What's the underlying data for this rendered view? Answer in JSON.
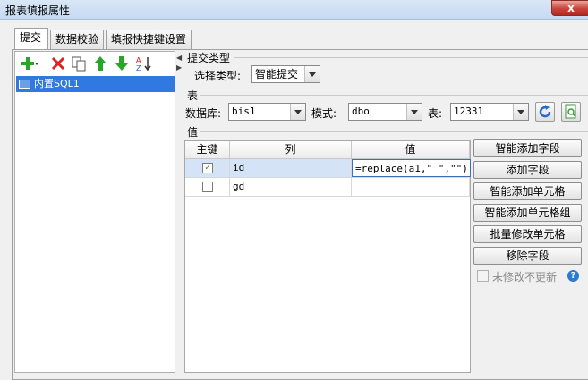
{
  "window": {
    "title": "报表填报属性",
    "close_label": "x"
  },
  "tabs": [
    {
      "label": "提交"
    },
    {
      "label": "数据校验"
    },
    {
      "label": "填报快捷键设置"
    }
  ],
  "left_panel": {
    "tree_items": [
      {
        "label": "内置SQL1"
      }
    ]
  },
  "submit_type": {
    "group_label": "提交类型",
    "label": "选择类型:",
    "value": "智能提交"
  },
  "table_group": {
    "group_label": "表",
    "db_label": "数据库:",
    "db_value": "bis1",
    "mode_label": "模式:",
    "mode_value": "dbo",
    "table_label": "表:",
    "table_value": "12331"
  },
  "value_group": {
    "group_label": "值",
    "columns": [
      "主键",
      "列",
      "值"
    ],
    "rows": [
      {
        "key": true,
        "column": "id",
        "value": "=replace(a1,\" \",\"\")"
      },
      {
        "key": false,
        "column": "gd",
        "value": ""
      }
    ]
  },
  "actions": [
    {
      "label": "智能添加字段"
    },
    {
      "label": "添加字段"
    },
    {
      "label": "智能添加单元格"
    },
    {
      "label": "智能添加单元格组"
    },
    {
      "label": "批量修改单元格"
    },
    {
      "label": "移除字段"
    }
  ],
  "no_update_unchanged": {
    "label": "未修改不更新",
    "checked": false
  },
  "colors": {
    "selection": "#3079e0",
    "row_highlight": "#d4e3f6",
    "add_green": "#2aa52a",
    "delete_red": "#e02020"
  }
}
